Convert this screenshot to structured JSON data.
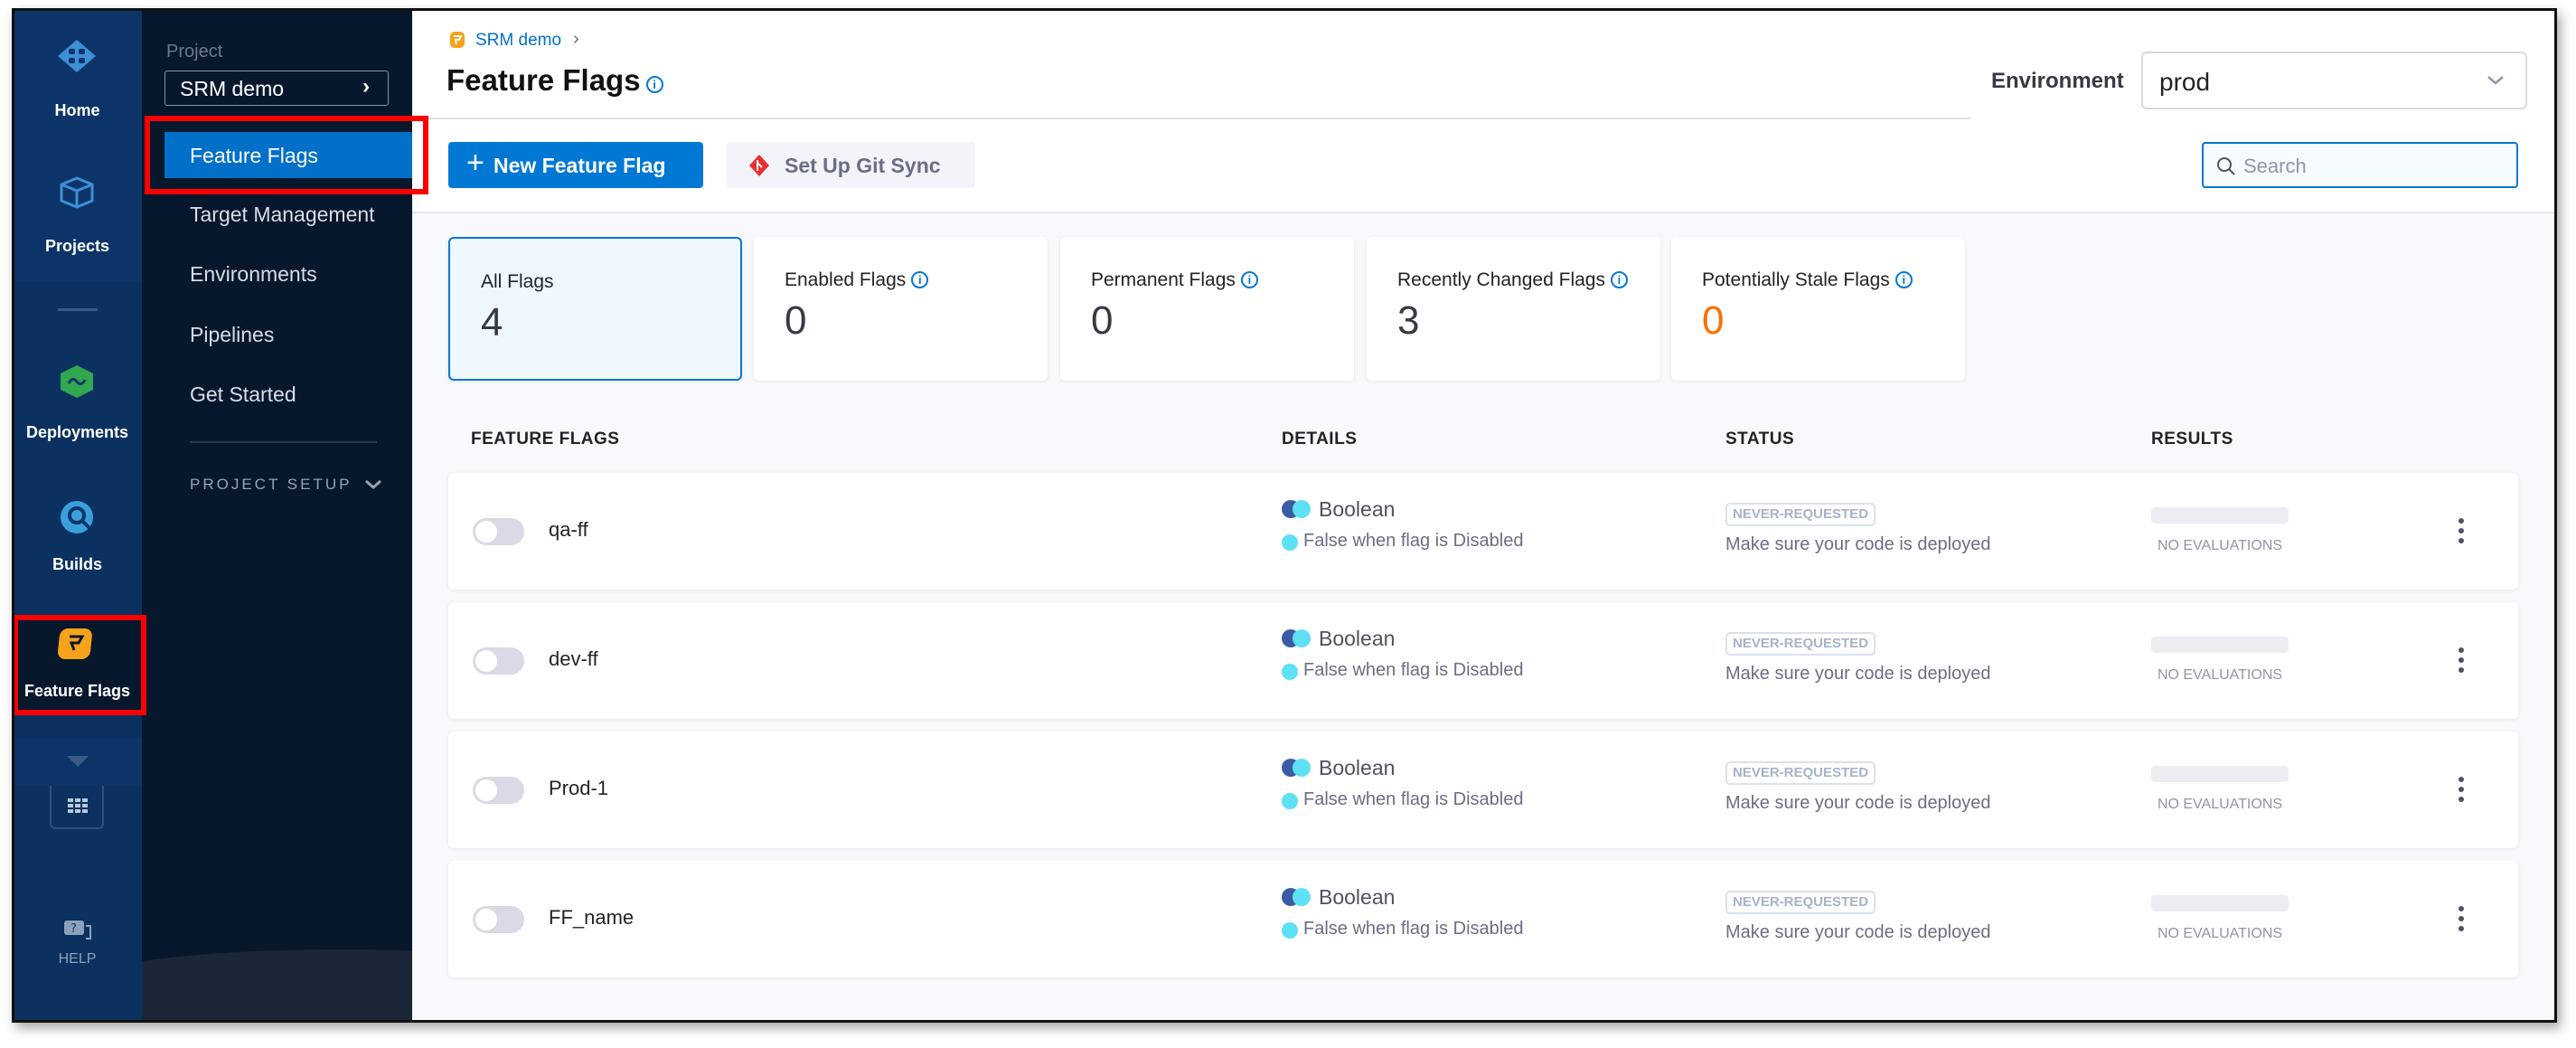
{
  "rail": {
    "items": [
      {
        "label": "Home",
        "icon": "home-icon"
      },
      {
        "label": "Projects",
        "icon": "projects-icon"
      },
      {
        "label": "Deployments",
        "icon": "deployments-icon"
      },
      {
        "label": "Builds",
        "icon": "builds-icon"
      },
      {
        "label": "Feature Flags",
        "icon": "feature-flags-icon"
      }
    ],
    "help_label": "HELP"
  },
  "sidebar": {
    "project_label": "Project",
    "project_value": "SRM demo",
    "items": [
      "Feature Flags",
      "Target Management",
      "Environments",
      "Pipelines",
      "Get Started"
    ],
    "section_label": "PROJECT SETUP"
  },
  "header": {
    "breadcrumb": "SRM demo",
    "title": "Feature Flags",
    "environment_label": "Environment",
    "environment_value": "prod"
  },
  "toolbar": {
    "new_flag_label": "New Feature Flag",
    "git_sync_label": "Set Up Git Sync",
    "search_placeholder": "Search"
  },
  "cards": [
    {
      "label": "All Flags",
      "value": "4",
      "info": false,
      "selected": true
    },
    {
      "label": "Enabled Flags",
      "value": "0",
      "info": true
    },
    {
      "label": "Permanent Flags",
      "value": "0",
      "info": true
    },
    {
      "label": "Recently Changed Flags",
      "value": "3",
      "info": true
    },
    {
      "label": "Potentially Stale Flags",
      "value": "0",
      "info": true,
      "color": "#ff6d00"
    }
  ],
  "table": {
    "headers": [
      "FEATURE FLAGS",
      "DETAILS",
      "STATUS",
      "RESULTS"
    ],
    "rows": [
      {
        "name": "qa-ff",
        "type": "Boolean",
        "sub": "False when flag is Disabled",
        "status": "NEVER-REQUESTED",
        "status_text": "Make sure your code is deployed",
        "results": "NO EVALUATIONS",
        "enabled": false
      },
      {
        "name": "dev-ff",
        "type": "Boolean",
        "sub": "False when flag is Disabled",
        "status": "NEVER-REQUESTED",
        "status_text": "Make sure your code is deployed",
        "results": "NO EVALUATIONS",
        "enabled": false
      },
      {
        "name": "Prod-1",
        "type": "Boolean",
        "sub": "False when flag is Disabled",
        "status": "NEVER-REQUESTED",
        "status_text": "Make sure your code is deployed",
        "results": "NO EVALUATIONS",
        "enabled": false
      },
      {
        "name": "FF_name",
        "type": "Boolean",
        "sub": "False when flag is Disabled",
        "status": "NEVER-REQUESTED",
        "status_text": "Make sure your code is deployed",
        "results": "NO EVALUATIONS",
        "enabled": false
      }
    ]
  },
  "colors": {
    "accent": "#0278d5",
    "highlight": "#ff0000",
    "stale": "#ff6d00"
  }
}
